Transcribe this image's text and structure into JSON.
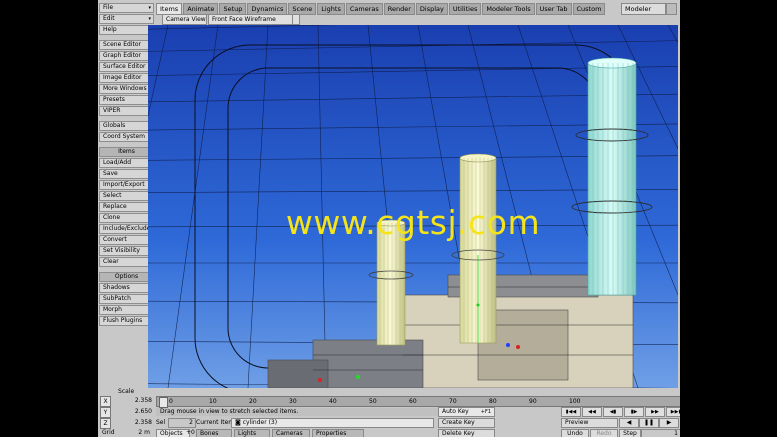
{
  "menu": {
    "top": [
      "File",
      "Edit",
      "Help"
    ],
    "group1": [
      "Scene Editor",
      "Graph Editor",
      "Surface Editor",
      "Image Editor",
      "More Windows",
      "Presets",
      "VIPER"
    ],
    "group2": [
      "Globals",
      "Coord System"
    ],
    "items_header": "Items",
    "items": [
      "Load/Add",
      "Save",
      "Import/Export",
      "Select",
      "Replace",
      "Clone",
      "Include/Exclude",
      "Convert",
      "Set Visibility",
      "Clear"
    ],
    "options_header": "Options",
    "options": [
      "Shadows",
      "SubPatch",
      "Morph",
      "Flush Plugins"
    ]
  },
  "tabs": [
    "Items",
    "Animate",
    "Setup",
    "Dynamics",
    "Scene",
    "Lights",
    "Cameras",
    "Render",
    "Display",
    "Utilities",
    "Modeler Tools",
    "User Tab",
    "Custom"
  ],
  "active_tab": "Items",
  "modeler_label": "Modeler",
  "viewport": {
    "view_select": "Camera View",
    "render_mode": "Front Face Wireframe",
    "watermark": "www.cgtsj.com"
  },
  "bottom": {
    "scale_label": "Scale",
    "coords": [
      {
        "axis": "X",
        "value": "2.358"
      },
      {
        "axis": "Y",
        "value": "2.650"
      },
      {
        "axis": "Z",
        "value": "2.358"
      }
    ],
    "timeline_ticks": [
      "0",
      "10",
      "20",
      "30",
      "40",
      "50",
      "60",
      "70",
      "80",
      "90",
      "100"
    ],
    "timeline_start": "0",
    "timeline_end": "100",
    "status_message": "Drag mouse in view to stretch selected items.",
    "auto_key": "Auto Key",
    "auto_key_shortcut": "+F1",
    "create_key": "Create Key",
    "delete_key": "Delete Key",
    "sel_label": "Sel",
    "sel_value": "2",
    "current_item_label": "Current Item",
    "current_item": "cylinder (3)",
    "grid_label": "Grid",
    "grid_value": "2 m",
    "bottom_tabs": [
      "Objects",
      "Bones",
      "Lights",
      "Cameras",
      "Properties"
    ],
    "objects_count": "+0",
    "preview": "Preview",
    "undo": "Undo",
    "redo": "Redo",
    "step": "Step",
    "step_value": "1"
  }
}
